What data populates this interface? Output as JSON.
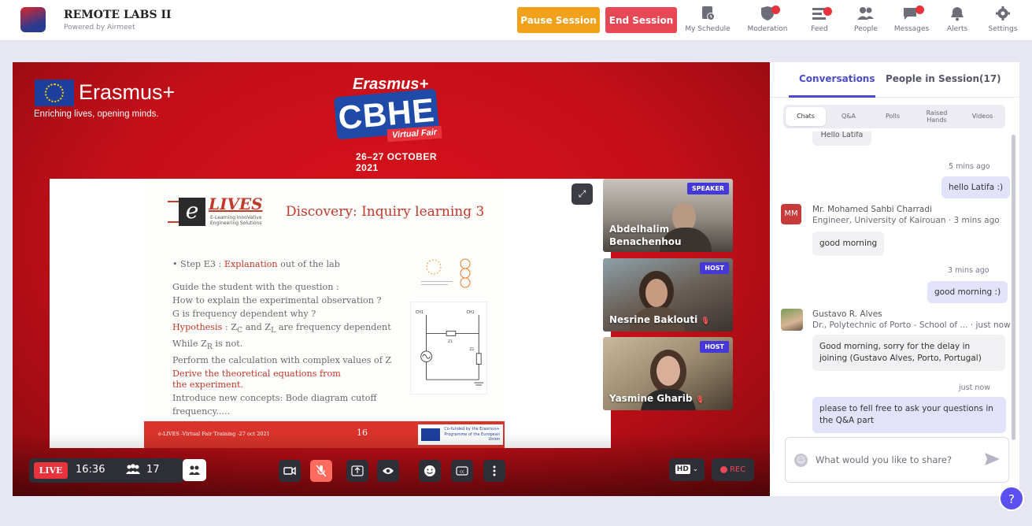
{
  "header": {
    "logo_text": "Erasmus+ CBHE",
    "title": "REMOTE LABS II",
    "subtitle": "Powered by Airmeet",
    "pause_label": "Pause Session",
    "end_label": "End Session",
    "nav": [
      {
        "label": "My Schedule",
        "icon": "schedule-icon"
      },
      {
        "label": "Moderation",
        "icon": "moderation-icon"
      },
      {
        "label": "Feed",
        "icon": "feed-icon"
      },
      {
        "label": "People",
        "icon": "people-icon"
      },
      {
        "label": "Messages",
        "icon": "messages-icon"
      },
      {
        "label": "Alerts",
        "icon": "bell-icon"
      },
      {
        "label": "Settings",
        "icon": "gear-icon"
      }
    ]
  },
  "banner": {
    "erasmus": "Erasmus+",
    "tagline": "Enriching lives, opening minds.",
    "cbhe_top": "Erasmus+",
    "cbhe_main": "CBHE",
    "cbhe_sub": "Virtual Fair",
    "cbhe_date": "26–27 OCTOBER 2021"
  },
  "slide": {
    "logo_name": "LIVES",
    "logo_sub": "E-Learning InnoVative Engineering Solutions",
    "title": "Discovery: Inquiry learning 3",
    "step_prefix": "• Step E3 : ",
    "step_red": "Explanation",
    "step_suffix": "  out of the lab",
    "line1": "Guide the student with the question :",
    "line2": "How to explain the experimental observation ?",
    "line3": "G is frequency dependent why ?",
    "hyp_red": "Hypothesis",
    "hyp_rest": " : Z",
    "hyp_c": "C",
    "hyp_and": " and  Z",
    "hyp_l": "L",
    "hyp_end": " are frequency dependent",
    "line5": "While Z",
    "line5_sub": "R",
    "line5_end": " is not.",
    "line6": "Perform the calculation with complex values of  Z",
    "line7": "Derive the theoretical equations from",
    "line8": " the experiment.",
    "line9": "Introduce new concepts: Bode diagram  cutoff frequency.....",
    "footer_left": "e-LIVES -Virtual Fair Training -27 oct 2021",
    "page_number": "16",
    "footer_eu": "Co-funded by the Erasmus+ Programme of the European Union",
    "circuit_ch1": "CH1",
    "circuit_ch2": "CH2",
    "circuit_z1": "Z1",
    "circuit_z2": "Z2"
  },
  "tiles": [
    {
      "badge": "SPEAKER",
      "name_line1": "Abdelhalim",
      "name_line2": "Benachenhou"
    },
    {
      "badge": "HOST",
      "name_line1": "Nesrine Baklouti",
      "name_line2": ""
    },
    {
      "badge": "HOST",
      "name_line1": "Yasmine Gharib",
      "name_line2": ""
    }
  ],
  "controls": {
    "live_label": "LIVE",
    "time": "16:36",
    "attendees": "17",
    "hd_label": "HD",
    "rec_label": "REC"
  },
  "panel": {
    "tab_conversations": "Conversations",
    "tab_people": "People in Session(17)",
    "subtabs": [
      "Chats",
      "Q&A",
      "Polls",
      "Raised Hands",
      "Videos"
    ],
    "clipped_bubble": "Hello Latifa",
    "messages": [
      {
        "time": "5 mins ago",
        "text": "hello Latifa :)"
      },
      {
        "avatar": "MM",
        "sender": "Mr. Mohamed Sahbi Charradi",
        "sender_sub": "Engineer, University of Kairouan · 3 mins ago",
        "text": "good morning"
      },
      {
        "time": "3 mins ago",
        "text": "good morning :)"
      },
      {
        "sender": "Gustavo R. Alves",
        "sender_sub": "Dr., Polytechnic of Porto - School of ...  · just now",
        "text": "Good morning, sorry for the delay in joining (Gustavo Alves, Porto, Portugal)"
      },
      {
        "time": "just now",
        "text": "please to fell free to ask your questions in the Q&A part"
      }
    ],
    "input_placeholder": "What would you like to share?"
  },
  "help_label": "?"
}
